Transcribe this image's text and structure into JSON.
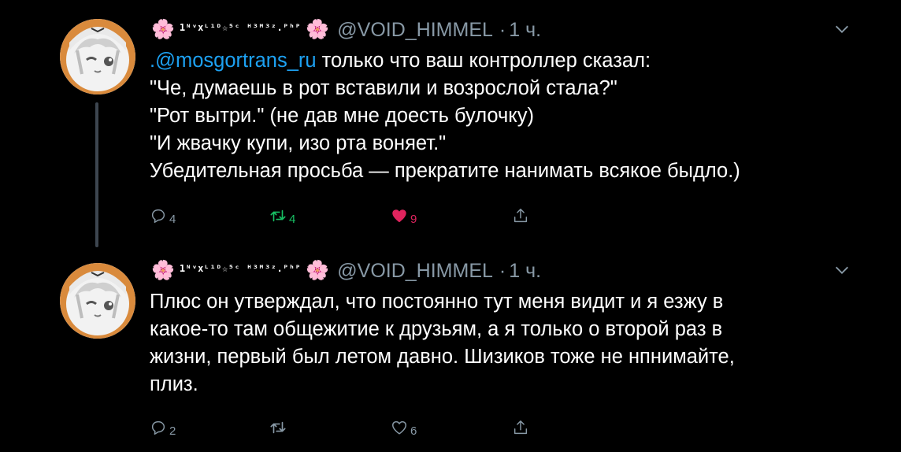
{
  "colors": {
    "background": "#000000",
    "text": "#ffffff",
    "secondary": "#8899a6",
    "mention": "#1da1f2",
    "retweet_active": "#17bf63",
    "like_active": "#e0245e",
    "thread_line": "#3d4650"
  },
  "tweets": [
    {
      "display_name": "1ᴺᵛxᴸ¹ᴰ☆⁵ᶜ ᴴ³ᴹ³ᶻ.ᴾʰᴾ",
      "flower_icon": "🌸",
      "handle": "@VOID_HIMMEL",
      "separator": "·",
      "time": "1 ч.",
      "lines": [
        {
          "mention": ".@mosgortrans_ru",
          "text": " только что ваш контроллер сказал:"
        },
        {
          "mention": "",
          "text": "\"Че, думаешь в рот вставили и возрослой стала?\""
        },
        {
          "mention": "",
          "text": "\"Рот вытри.\" (не дав мне доесть булочку)"
        },
        {
          "mention": "",
          "text": "\"И жвачку купи, изо рта воняет.\""
        },
        {
          "mention": "",
          "text": "Убедительная просьба — прекратите нанимать всякое быдло.)"
        }
      ],
      "replies": "4",
      "retweets": "4",
      "likes": "9",
      "retweeted": true,
      "liked": true
    },
    {
      "display_name": "1ᴺᵛxᴸ¹ᴰ☆⁵ᶜ ᴴ³ᴹ³ᶻ.ᴾʰᴾ",
      "flower_icon": "🌸",
      "handle": "@VOID_HIMMEL",
      "separator": "·",
      "time": "1 ч.",
      "lines": [
        {
          "mention": "",
          "text": "Плюс он утверждал, что постоянно тут меня видит и я езжу в"
        },
        {
          "mention": "",
          "text": "какое-то там общежитие к друзьям, а я только о второй раз в"
        },
        {
          "mention": "",
          "text": "жизни, первый был летом давно. Шизиков тоже не нпнимайте,"
        },
        {
          "mention": "",
          "text": "плиз."
        }
      ],
      "replies": "2",
      "retweets": "",
      "likes": "6",
      "retweeted": false,
      "liked": false
    }
  ]
}
